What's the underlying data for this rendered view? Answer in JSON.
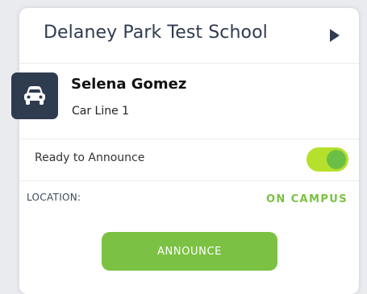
{
  "header": {
    "school_name": "Delaney Park Test School",
    "nav_icon": "play-arrow-icon"
  },
  "rider": {
    "name": "Selena Gomez",
    "line": "Car Line 1",
    "badge_icon": "car-icon"
  },
  "ready": {
    "label": "Ready to Announce",
    "toggle_on": true
  },
  "location": {
    "label": "LOCATION:",
    "value": "ON CAMPUS"
  },
  "actions": {
    "announce_label": "ANNOUNCE"
  },
  "colors": {
    "primary_dark": "#2f3b4f",
    "accent_green": "#7bc143",
    "toggle_track": "#b5e02b",
    "toggle_knob": "#6bbf45"
  }
}
